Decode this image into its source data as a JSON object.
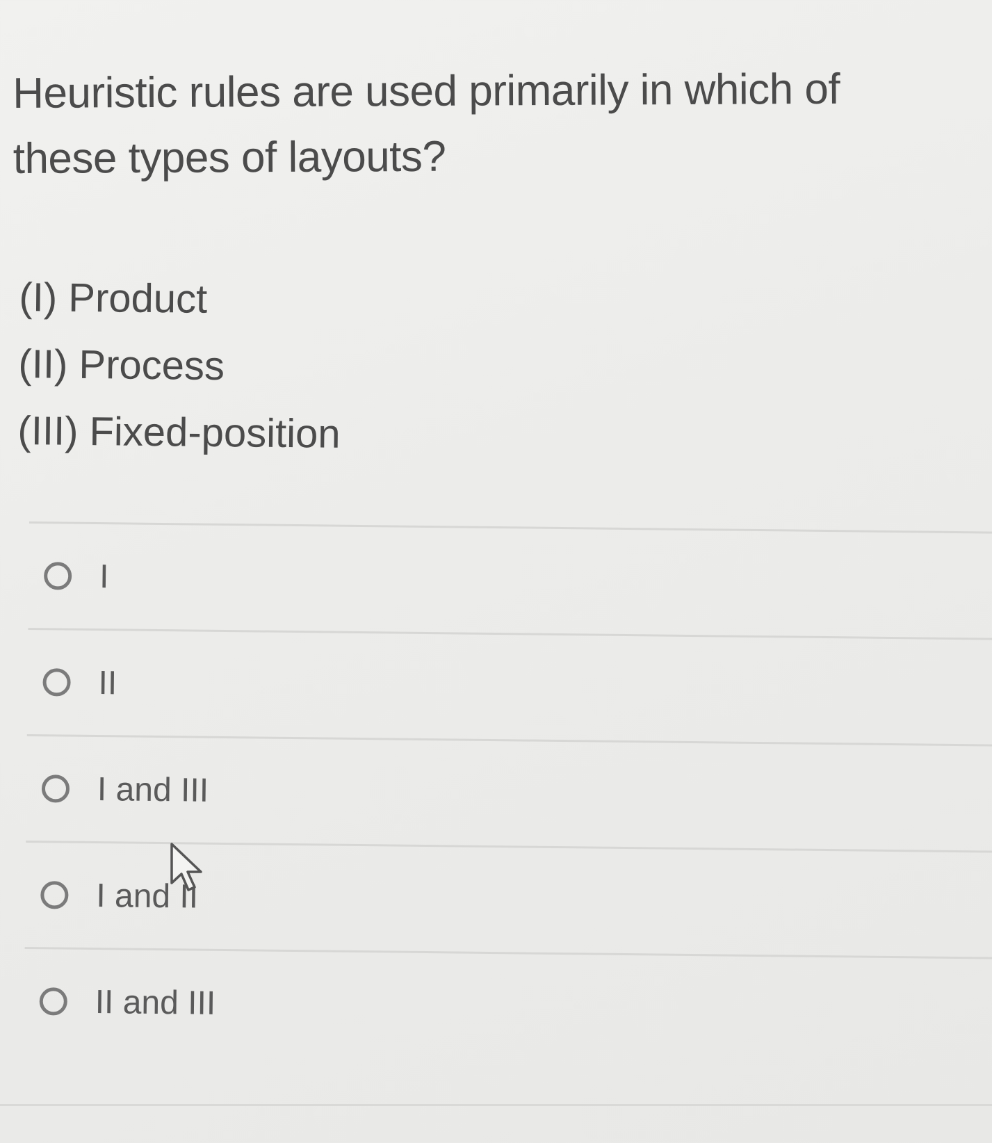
{
  "question": {
    "text_line1": "Heuristic rules are used primarily in which of",
    "text_line2": "these types of layouts?"
  },
  "statements": [
    "(I) Product",
    "(II) Process",
    "(III) Fixed-position"
  ],
  "options": [
    {
      "label": "I",
      "selected": false
    },
    {
      "label": "II",
      "selected": false
    },
    {
      "label": "I and III",
      "selected": false
    },
    {
      "label": "I and II",
      "selected": false
    },
    {
      "label": "II and III",
      "selected": false
    }
  ],
  "icons": {
    "radio": "radio-unchecked-icon",
    "cursor": "mouse-pointer-icon"
  },
  "colors": {
    "background": "#ececea",
    "text": "#4b4b4b",
    "divider": "#d7d7d5",
    "radio_border": "#7b7b7b"
  }
}
